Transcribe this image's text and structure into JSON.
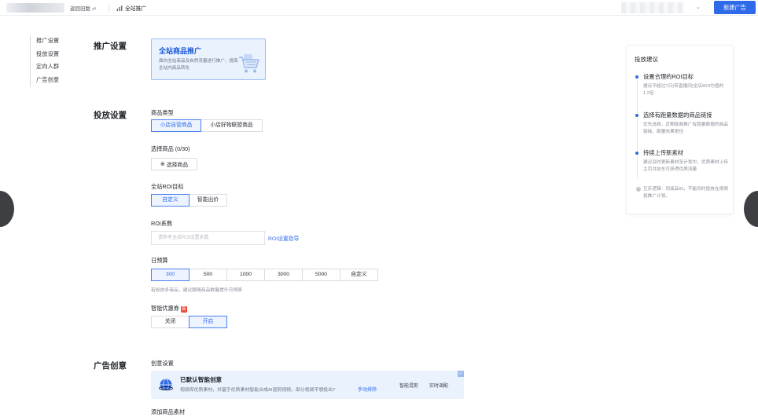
{
  "topbar": {
    "back_label": "返回旧版",
    "title": "全站推广",
    "new_ad_button": "新建广告"
  },
  "leftnav": {
    "items": [
      {
        "label": "推广设置"
      },
      {
        "label": "投放设置"
      },
      {
        "label": "定向人群"
      },
      {
        "label": "广告创意"
      }
    ]
  },
  "sections": {
    "promotion": "推广设置",
    "delivery": "投放设置",
    "creative": "广告创意"
  },
  "promo_card": {
    "title": "全站商品推广",
    "desc": "面向全站商品及自然流量进行推广，提高全站内商品转化"
  },
  "product_type": {
    "label": "商品类型",
    "options": [
      "小店自营商品",
      "小店好物联盟商品"
    ],
    "selected": "小店自营商品"
  },
  "select_products": {
    "label": "选择商品 (0/30)",
    "button": "选择商品"
  },
  "roi_goal": {
    "label": "全站ROI目标",
    "options": [
      "自定义",
      "智能出价"
    ],
    "selected": "自定义"
  },
  "roi_coef": {
    "label": "ROI系数",
    "placeholder": "请参考全店ROI设置系数",
    "guide_link": "ROI设置指导"
  },
  "budget": {
    "label": "日预算",
    "options": [
      "300",
      "500",
      "1000",
      "3000",
      "5000",
      "自定义"
    ],
    "selected": "300",
    "hint": "若投放多商品，建议跟随商品数量提升日预算"
  },
  "smart_coupon": {
    "label": "智能优惠券",
    "badge": "新",
    "options": [
      "关闭",
      "开启"
    ],
    "selected": "开启"
  },
  "creative": {
    "settings_label": "创意设置",
    "banner_title": "已默认智能创意",
    "banner_desc": "视频库优质素材，并基于优质素材智能合成AI混剪视频，部分视频不想投出?",
    "banner_link": "手动排除",
    "btn_smart": "智能混剪",
    "btn_realtime": "实时调配",
    "add_material_label": "添加商品素材"
  },
  "tips": {
    "title": "投放建议",
    "items": [
      {
        "head": "设置合理的ROI目标",
        "body": "建议不超过7日(带直播间)全店ROI均值的 1.2倍"
      },
      {
        "head": "选择有跑量数据的商品链接",
        "body": "优先选择，近期视频推广有跑量数据的商品链接，跑量效果更佳"
      },
      {
        "head": "持续上传新素材",
        "body": "建议及时更新素材至计划中，优质素材上传主页并挂车可获得优质流量"
      }
    ],
    "note": "互斥逻辑：同商品ID，不能同时投放在视频投推广计划。"
  },
  "colors": {
    "primary": "#2f6be8",
    "card_bg": "#eaf2fe",
    "badge_red": "#f04a3a"
  }
}
